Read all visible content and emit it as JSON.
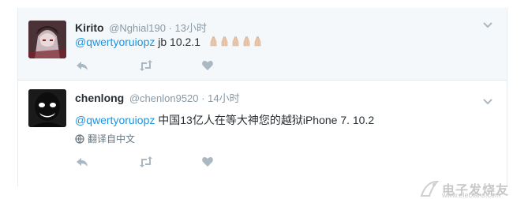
{
  "tweets": [
    {
      "name": "Kirito",
      "handle": "@Nghial190",
      "separator": "·",
      "time": "13小时",
      "mention": "@qwertyoruiopz",
      "text": " jb 10.2.1",
      "emoji_count": 5
    },
    {
      "name": "chenlong",
      "handle": "@chenlon9520",
      "separator": "·",
      "time": "14小时",
      "mention": "@qwertyoruiopz",
      "text": " 中国13亿人在等大神您的越狱iPhone 7. 10.2",
      "translate_label": "翻译自中文"
    }
  ],
  "watermark": {
    "title": "电子发烧友",
    "url": "www.elecfans.com"
  },
  "colors": {
    "link": "#1b95e0",
    "muted": "#8899a6",
    "highlight_bg": "#f5f8fa"
  },
  "icons": [
    "reply-icon",
    "retweet-icon",
    "like-icon",
    "chevron-down-icon",
    "globe-icon",
    "folded-hands-emoji"
  ]
}
